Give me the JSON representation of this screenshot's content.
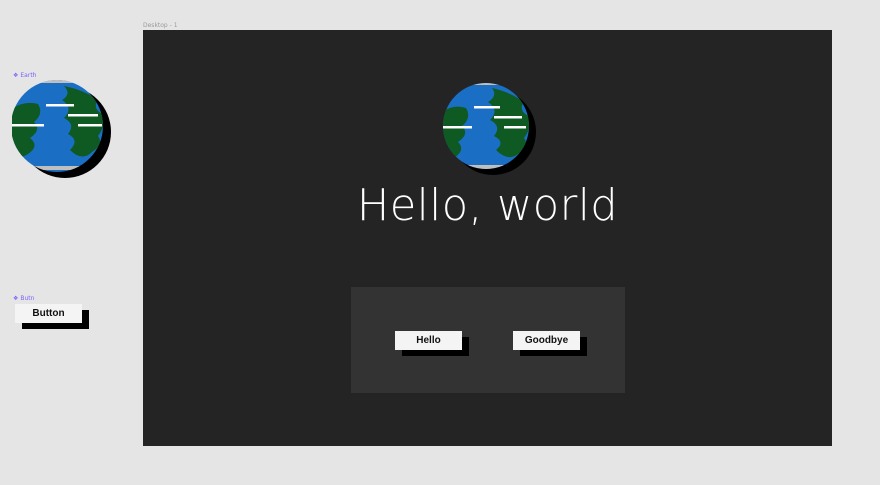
{
  "components": {
    "earth_label": "Earth",
    "button_label_tag": "Butn",
    "button_text": "Button"
  },
  "frame": {
    "label": "Desktop - 1",
    "title": "Hello, world",
    "hello_button": "Hello",
    "goodbye_button": "Goodbye"
  },
  "colors": {
    "canvas": "#e5e5e5",
    "frame_bg": "#242424",
    "panel_bg": "#333333",
    "button_bg": "#f4f4f4",
    "ocean": "#1a6fc4",
    "land": "#0e5a22",
    "component_accent": "#7b61ff"
  },
  "icons": {
    "earth": "earth-globe-icon",
    "component": "component-diamond-icon"
  }
}
